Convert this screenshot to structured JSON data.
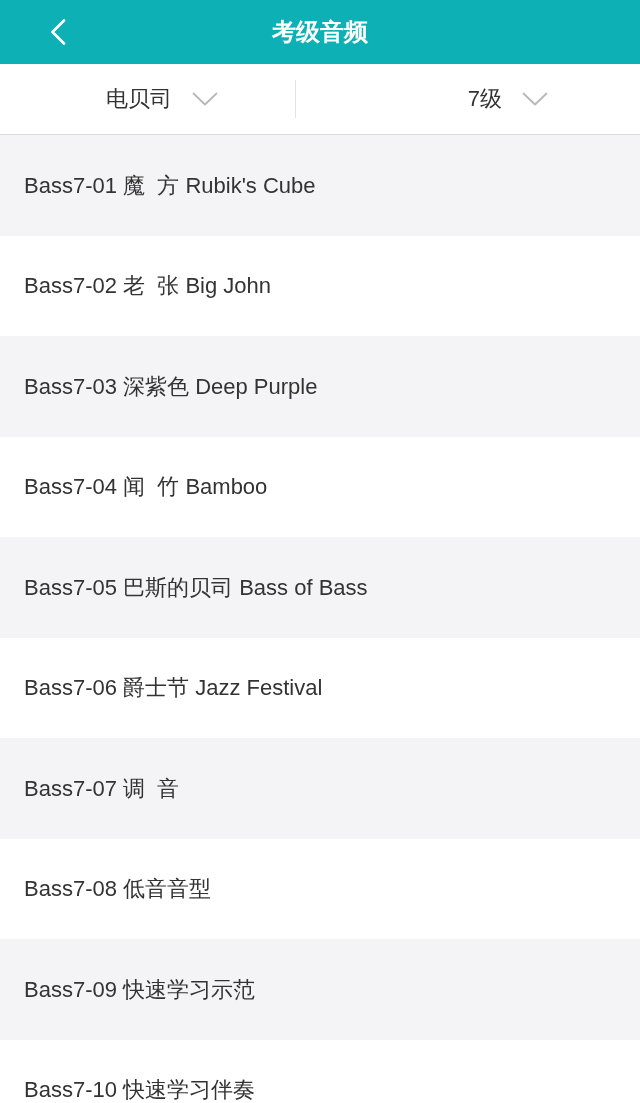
{
  "header": {
    "title": "考级音频"
  },
  "filters": [
    {
      "label": "电贝司"
    },
    {
      "label": "7级"
    }
  ],
  "tracks": [
    {
      "title": "Bass7-01 魔  方 Rubik's Cube"
    },
    {
      "title": "Bass7-02 老  张 Big John"
    },
    {
      "title": "Bass7-03 深紫色 Deep Purple"
    },
    {
      "title": "Bass7-04 闻  竹 Bamboo"
    },
    {
      "title": "Bass7-05 巴斯的贝司 Bass of Bass"
    },
    {
      "title": "Bass7-06 爵士节 Jazz Festival"
    },
    {
      "title": "Bass7-07 调  音"
    },
    {
      "title": "Bass7-08 低音音型"
    },
    {
      "title": "Bass7-09 快速学习示范"
    },
    {
      "title": "Bass7-10 快速学习伴奏"
    }
  ]
}
